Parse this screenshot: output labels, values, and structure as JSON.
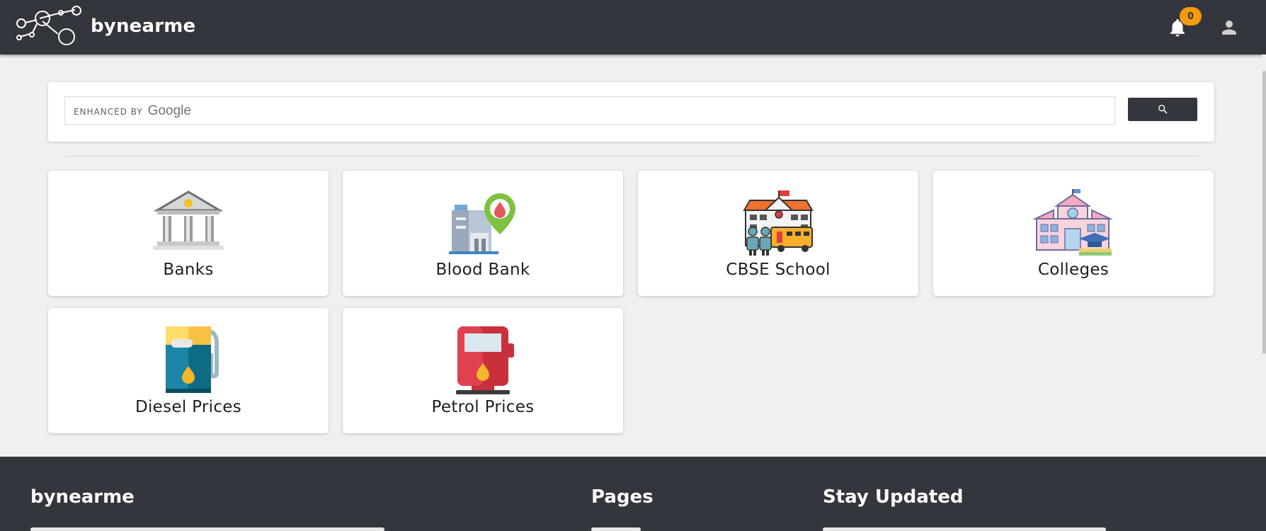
{
  "header": {
    "brand": "bynearme",
    "notification_count": "0",
    "icons": [
      "network-logo-icon",
      "bell-icon",
      "user-icon"
    ]
  },
  "search": {
    "watermark_small": "ENHANCED BY",
    "watermark_google": "Google",
    "value": "",
    "button_icon": "search-icon"
  },
  "categories": [
    {
      "label": "Banks",
      "icon": "bank-building-icon"
    },
    {
      "label": "Blood Bank",
      "icon": "blood-bank-icon"
    },
    {
      "label": "CBSE School",
      "icon": "school-icon"
    },
    {
      "label": "Colleges",
      "icon": "college-icon"
    },
    {
      "label": "Diesel Prices",
      "icon": "diesel-pump-icon"
    },
    {
      "label": "Petrol Prices",
      "icon": "petrol-pump-icon"
    }
  ],
  "footer": {
    "brand": "bynearme",
    "pages_heading": "Pages",
    "stay_updated_heading": "Stay Updated"
  },
  "colors": {
    "header_bg": "#33363d",
    "page_bg": "#f1f0ee",
    "badge": "#f49b0e"
  }
}
